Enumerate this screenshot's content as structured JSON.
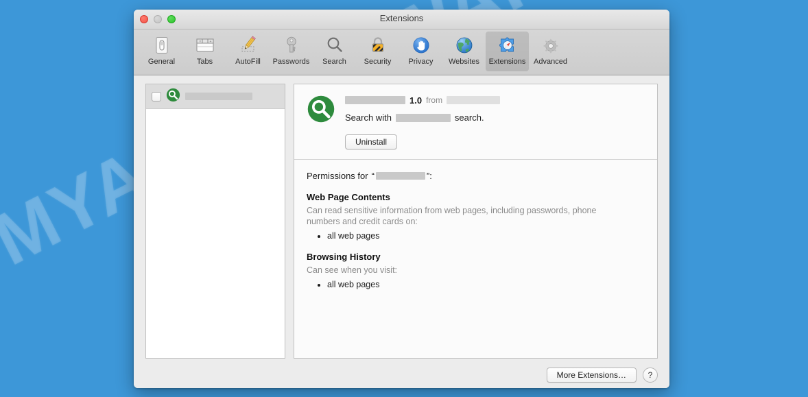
{
  "desktop": {
    "background_color": "#3d97d8",
    "watermark_text": "MYANTISPYWARE.COM"
  },
  "window": {
    "title": "Extensions",
    "traffic_lights": {
      "close": "close-button",
      "minimize": "minimize-button",
      "zoom": "zoom-button"
    }
  },
  "toolbar": {
    "items": [
      {
        "label": "General",
        "icon": "general-icon",
        "selected": false
      },
      {
        "label": "Tabs",
        "icon": "tabs-icon",
        "selected": false
      },
      {
        "label": "AutoFill",
        "icon": "autofill-icon",
        "selected": false
      },
      {
        "label": "Passwords",
        "icon": "passwords-icon",
        "selected": false
      },
      {
        "label": "Search",
        "icon": "search-icon",
        "selected": false
      },
      {
        "label": "Security",
        "icon": "security-icon",
        "selected": false
      },
      {
        "label": "Privacy",
        "icon": "privacy-icon",
        "selected": false
      },
      {
        "label": "Websites",
        "icon": "websites-icon",
        "selected": false
      },
      {
        "label": "Extensions",
        "icon": "extensions-icon",
        "selected": true
      },
      {
        "label": "Advanced",
        "icon": "advanced-icon",
        "selected": false
      }
    ]
  },
  "sidebar": {
    "rows": [
      {
        "checked": false,
        "icon": "extension-search-icon",
        "name_redacted": true,
        "name_redacted_width": 98
      }
    ]
  },
  "detail": {
    "icon": "extension-search-icon",
    "name_redacted_width": 88,
    "version": "1.0",
    "from_label": "from",
    "vendor_redacted_width": 78,
    "description_prefix": "Search with",
    "description_redacted_width": 80,
    "description_suffix": "search.",
    "uninstall_label": "Uninstall",
    "permissions_prefix": "Permissions for",
    "permissions_quote_open": "“",
    "permissions_quote_close": "”:",
    "permissions_name_redacted_width": 72,
    "groups": [
      {
        "heading": "Web Page Contents",
        "description": "Can read sensitive information from web pages, including passwords, phone numbers and credit cards on:",
        "items": [
          "all web pages"
        ]
      },
      {
        "heading": "Browsing History",
        "description": "Can see when you visit:",
        "items": [
          "all web pages"
        ]
      }
    ]
  },
  "footer": {
    "more_extensions_label": "More Extensions…",
    "help_label": "?"
  },
  "colors": {
    "accent_green": "#2e8b3d",
    "window_chrome": "#ececec",
    "toolbar": "#d2d2d2",
    "redaction": "#c9c9c9",
    "muted_text": "#8b8b8b"
  }
}
